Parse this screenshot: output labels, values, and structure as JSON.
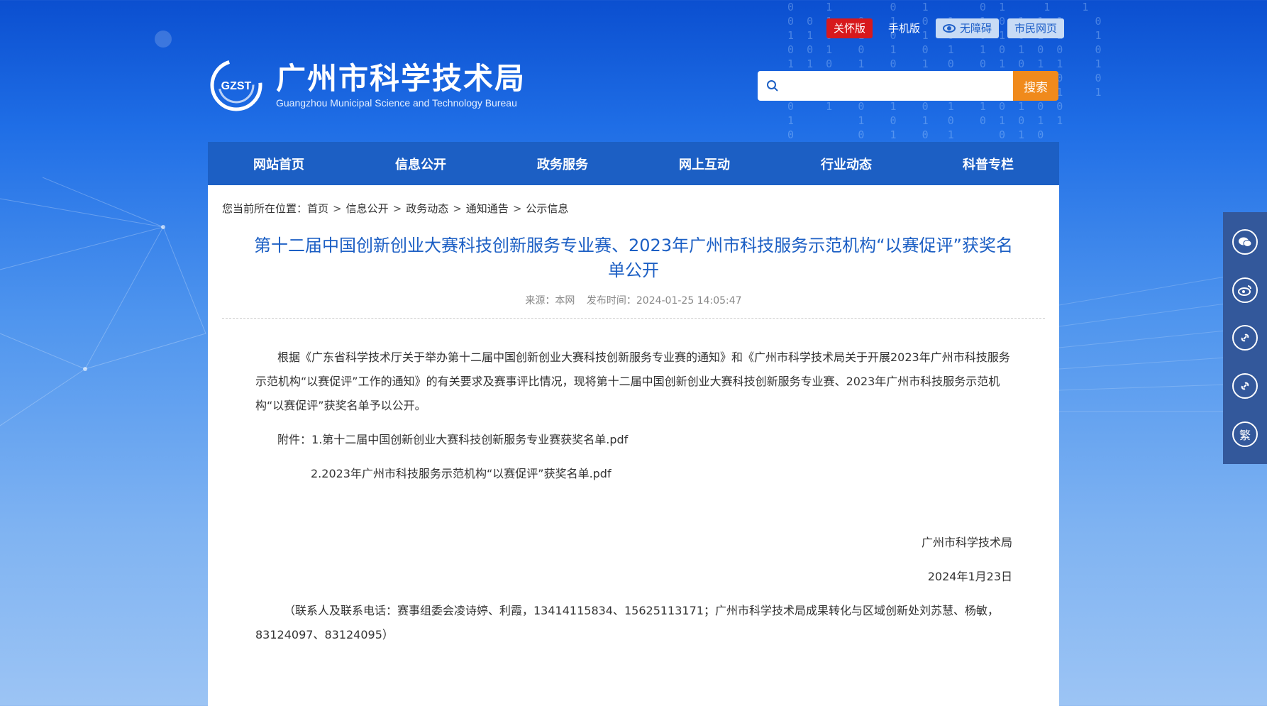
{
  "header": {
    "top_links": {
      "care": "关怀版",
      "mobile": "手机版",
      "accessibility": "无障碍",
      "citizen": "市民网页"
    },
    "logo": {
      "mark_text": "GZST",
      "name_cn": "广州市科学技术局",
      "name_en": "Guangzhou Municipal Science and Technology Bureau"
    },
    "search": {
      "placeholder": "",
      "button": "搜索"
    }
  },
  "nav": [
    {
      "label": "网站首页"
    },
    {
      "label": "信息公开"
    },
    {
      "label": "政务服务"
    },
    {
      "label": "网上互动"
    },
    {
      "label": "行业动态"
    },
    {
      "label": "科普专栏"
    }
  ],
  "breadcrumb": {
    "prefix": "您当前所在位置：",
    "items": [
      "首页",
      "信息公开",
      "政务动态",
      "通知通告",
      "公示信息"
    ]
  },
  "article": {
    "title": "第十二届中国创新创业大赛科技创新服务专业赛、2023年广州市科技服务示范机构“以赛促评”获奖名单公开",
    "source": "来源：本网",
    "publish_time": "发布时间：2024-01-25 14:05:47",
    "paragraph": "根据《广东省科学技术厅关于举办第十二届中国创新创业大赛科技创新服务专业赛的通知》和《广州市科学技术局关于开展2023年广州市科技服务示范机构“以赛促评”工作的通知》的有关要求及赛事评比情况，现将第十二届中国创新创业大赛科技创新服务专业赛、2023年广州市科技服务示范机构“以赛促评”获奖名单予以公开。",
    "attachment_label": "附件：",
    "attachments": [
      "1.第十二届中国创新创业大赛科技创新服务专业赛获奖名单.pdf",
      "2.2023年广州市科技服务示范机构“以赛促评”获奖名单.pdf"
    ],
    "signature_org": "广州市科学技术局",
    "signature_date": "2024年1月23日",
    "contact": "（联系人及联系电话：赛事组委会凌诗婷、利霞，13414115834、15625113171；广州市科学技术局成果转化与区域创新处刘苏慧、杨敏，83124097、83124095）"
  },
  "side_toolbar": {
    "items": [
      "wechat-icon",
      "weibo-icon",
      "link-icon",
      "link-icon",
      "traditional-chinese-icon"
    ],
    "traditional_label": "繁"
  },
  "colors": {
    "nav_bg": "#1c5fc4",
    "title": "#1c5fc4",
    "search_button": "#f08a1c",
    "care_badge": "#d7191c",
    "side_toolbar": "#33589b"
  }
}
